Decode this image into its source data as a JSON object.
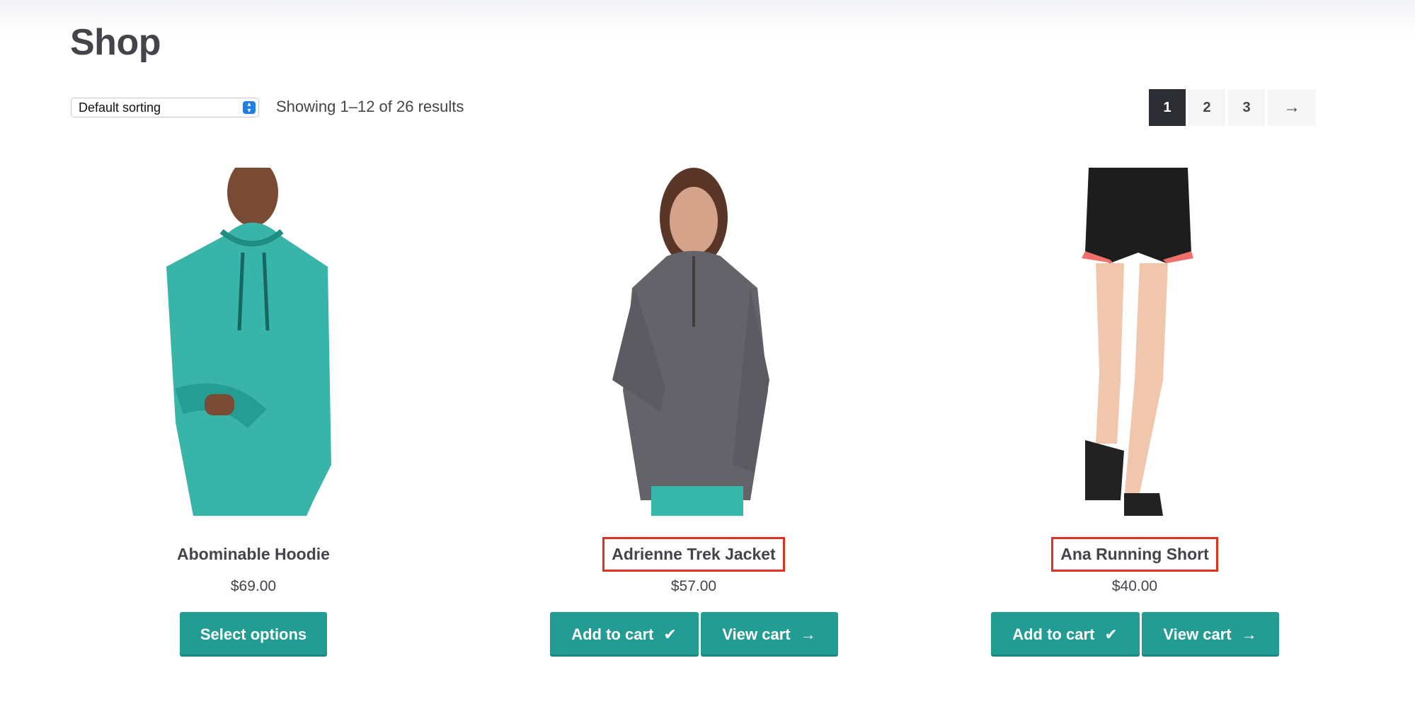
{
  "page": {
    "title": "Shop"
  },
  "toolbar": {
    "sort_value": "Default sorting",
    "result_count": "Showing 1–12 of 26 results"
  },
  "pagination": {
    "pages": [
      "1",
      "2",
      "3"
    ],
    "current": "1",
    "next_label": "→"
  },
  "products": [
    {
      "name": "Abominable Hoodie",
      "price": "$69.00",
      "button": "Select options",
      "color": "#39b4a8"
    },
    {
      "name": "Adrienne Trek Jacket",
      "price": "$57.00",
      "button": "Add to cart",
      "secondary_button": "View cart",
      "color": "#64636a"
    },
    {
      "name": "Ana Running Short",
      "price": "$40.00",
      "button": "Add to cart",
      "secondary_button": "View cart",
      "color": "#1d1d1d"
    }
  ],
  "icons": {
    "check": "check-icon",
    "arrow": "arrow-right-icon"
  },
  "colors": {
    "accent": "#239c94",
    "highlight": "#e0301e",
    "dark": "#2c2d33"
  }
}
